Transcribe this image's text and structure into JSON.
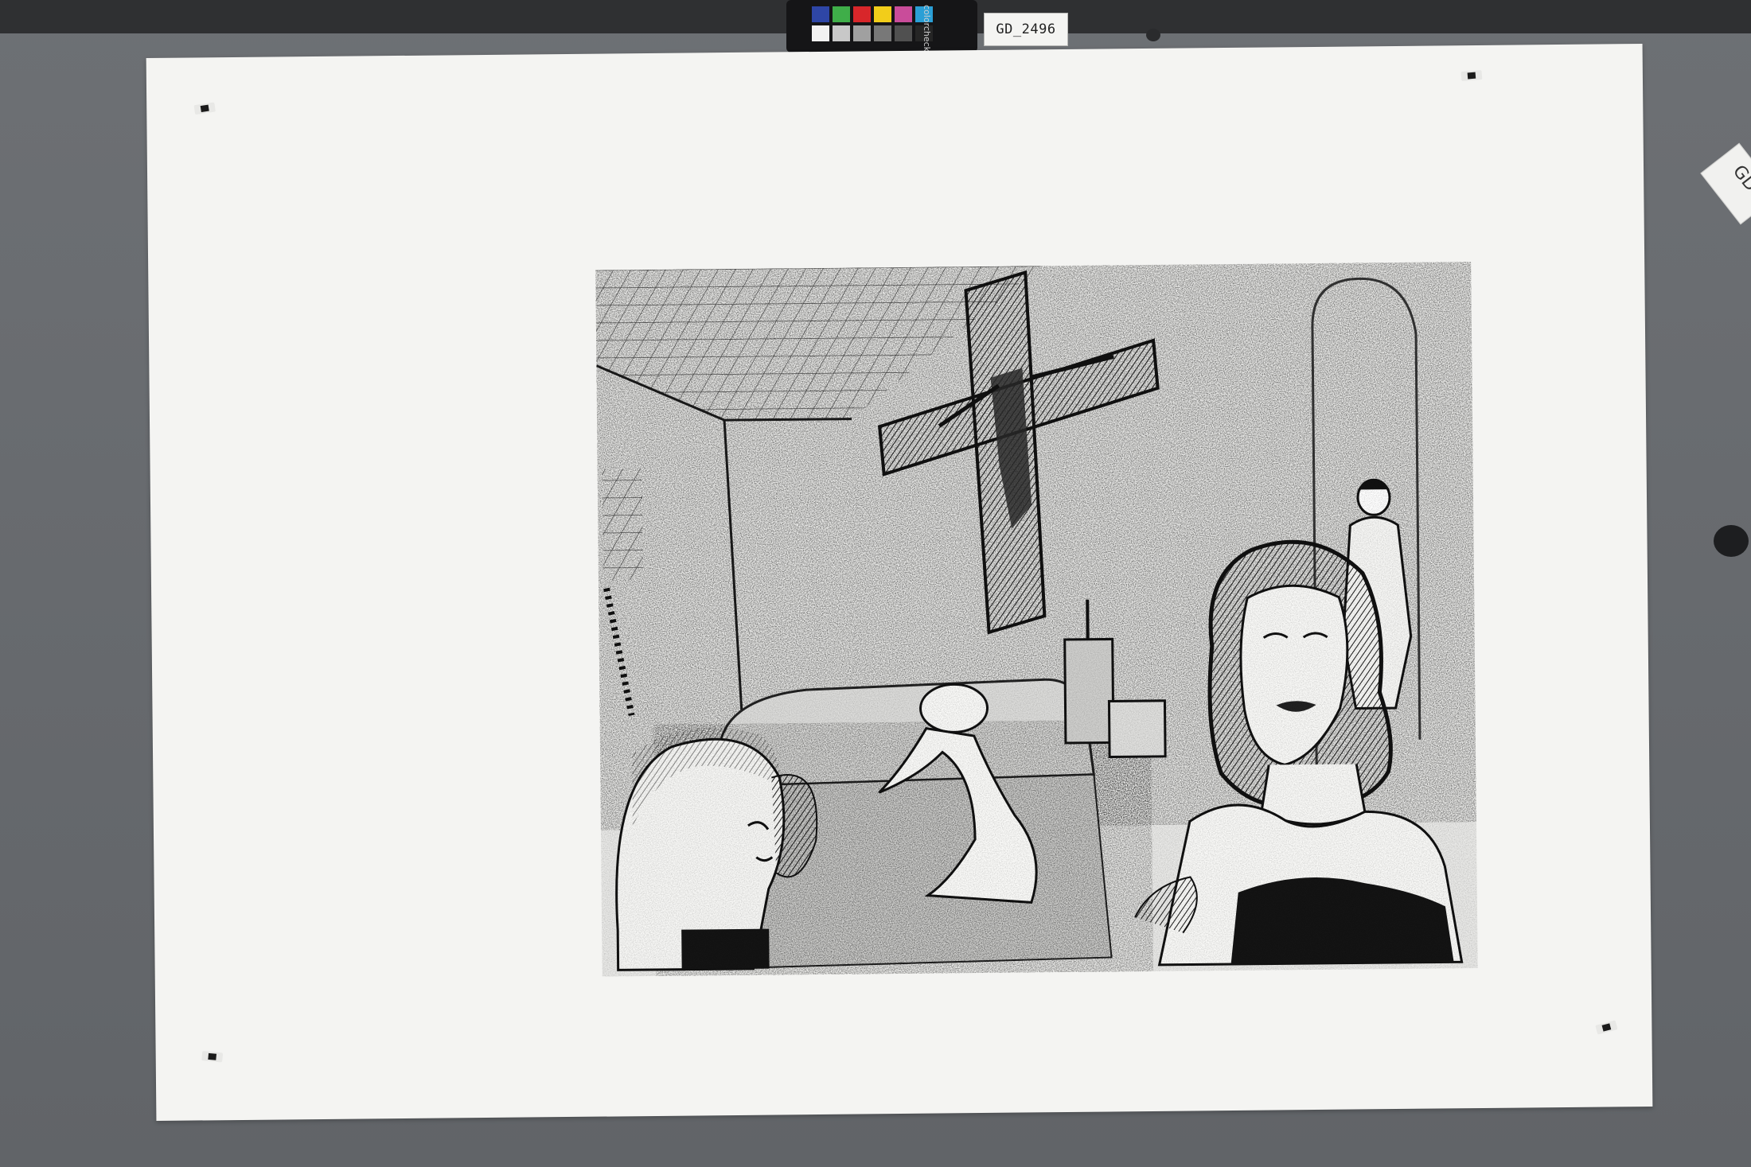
{
  "scene": {
    "id_label": "GD_2496",
    "edge_tag_text": "GD",
    "checker_brand": "colorchecker",
    "colors": {
      "board": "#6a6d71",
      "board_dark_strip": "#2f3032",
      "paper": "#f4f4f2",
      "ink": "#141414"
    },
    "checker_swatches": [
      "#2e46a6",
      "#3fae49",
      "#d8262a",
      "#f2cd1a",
      "#c94c9a",
      "#2a9fd6",
      "#f2f2f2",
      "#c8c8c8",
      "#a0a0a0",
      "#787878",
      "#505050",
      "#252525"
    ],
    "artwork": {
      "type": "monochrome etching",
      "motifs": [
        "crucifix on wall",
        "tiled ceiling",
        "seated woman with dark curly hair looking up",
        "woman with short hair in foreground left",
        "small nude figure on bed",
        "nude figure in arched doorway"
      ]
    }
  }
}
